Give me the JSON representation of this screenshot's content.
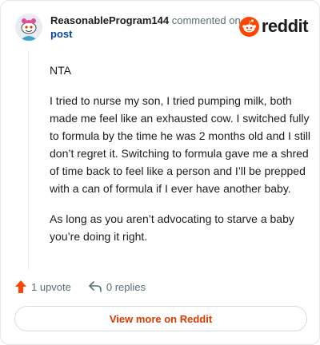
{
  "header": {
    "username": "ReasonableProgram144",
    "commented_text": " commented on",
    "post_link": "post",
    "brand_name": "reddit"
  },
  "comment": {
    "paragraphs": [
      "NTA",
      "I tried to nurse my son, I tried pumping milk, both made me feel like an exhausted cow. I switched fully to formula by the time he was 2 months old and I still don’t regret it. Switching to formula gave me a shred of time back to feel like a person and I’ll be prepped with a can of formula if I ever have another baby.",
      "As long as you aren’t advocating to starve a baby you’re doing it right."
    ]
  },
  "actions": {
    "upvote_label": "1 upvote",
    "reply_label": "0 replies"
  },
  "footer": {
    "view_more_label": "View more on Reddit"
  },
  "icons": {
    "avatar": "snoo-avatar-icon",
    "brand": "reddit-logo-icon",
    "upvote": "upvote-arrow-icon",
    "reply": "reply-arrow-icon"
  },
  "colors": {
    "accent": "#ff4500",
    "link": "#0a449b",
    "muted": "#576f76",
    "view_more": "#d93a00"
  }
}
